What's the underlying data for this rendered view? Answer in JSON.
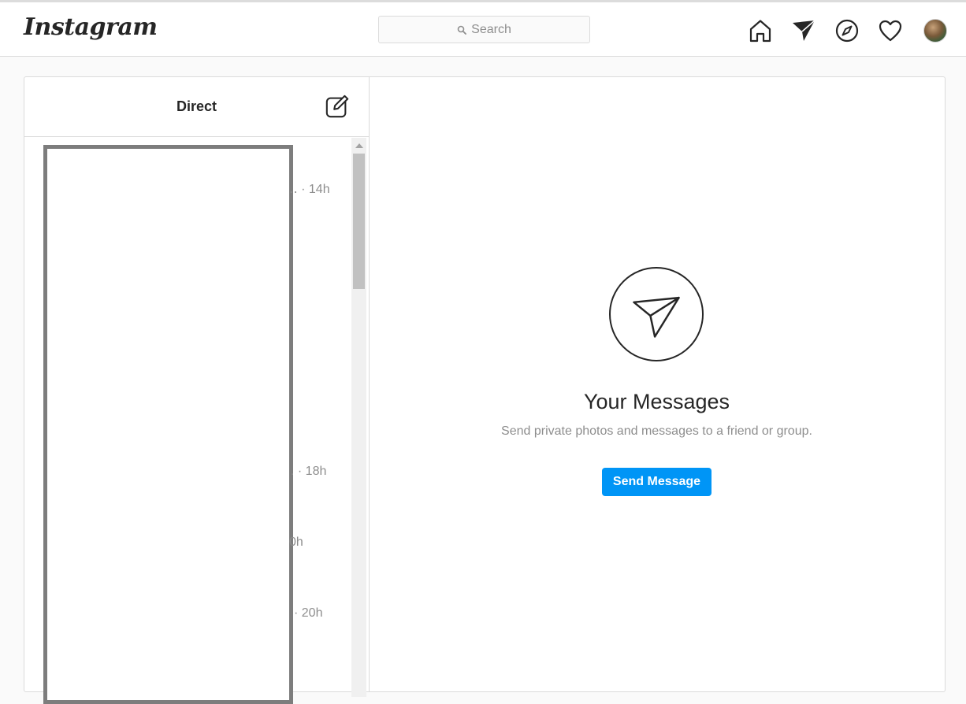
{
  "app": {
    "logo_text": "Instagram"
  },
  "header": {
    "search": {
      "placeholder": "Search"
    },
    "icons": [
      "home-icon",
      "direct-icon",
      "explore-icon",
      "activity-heart-icon",
      "profile-avatar"
    ]
  },
  "inbox": {
    "title": "Direct",
    "compose_icon": "new-message-icon",
    "times": [
      {
        "text": "‥ · 14h"
      },
      {
        "text": ". · 18h"
      },
      {
        "text": "0h"
      },
      {
        "text": "· 20h"
      }
    ]
  },
  "empty_state": {
    "icon": "paper-plane-icon",
    "title": "Your Messages",
    "subtitle": "Send private photos and messages to a friend or group.",
    "button_label": "Send Message"
  },
  "colors": {
    "accent": "#0095f6",
    "border": "#dbdbdb",
    "background": "#fafafa",
    "muted_text": "#8e8e8e",
    "redaction_border": "#7d7d7d"
  }
}
